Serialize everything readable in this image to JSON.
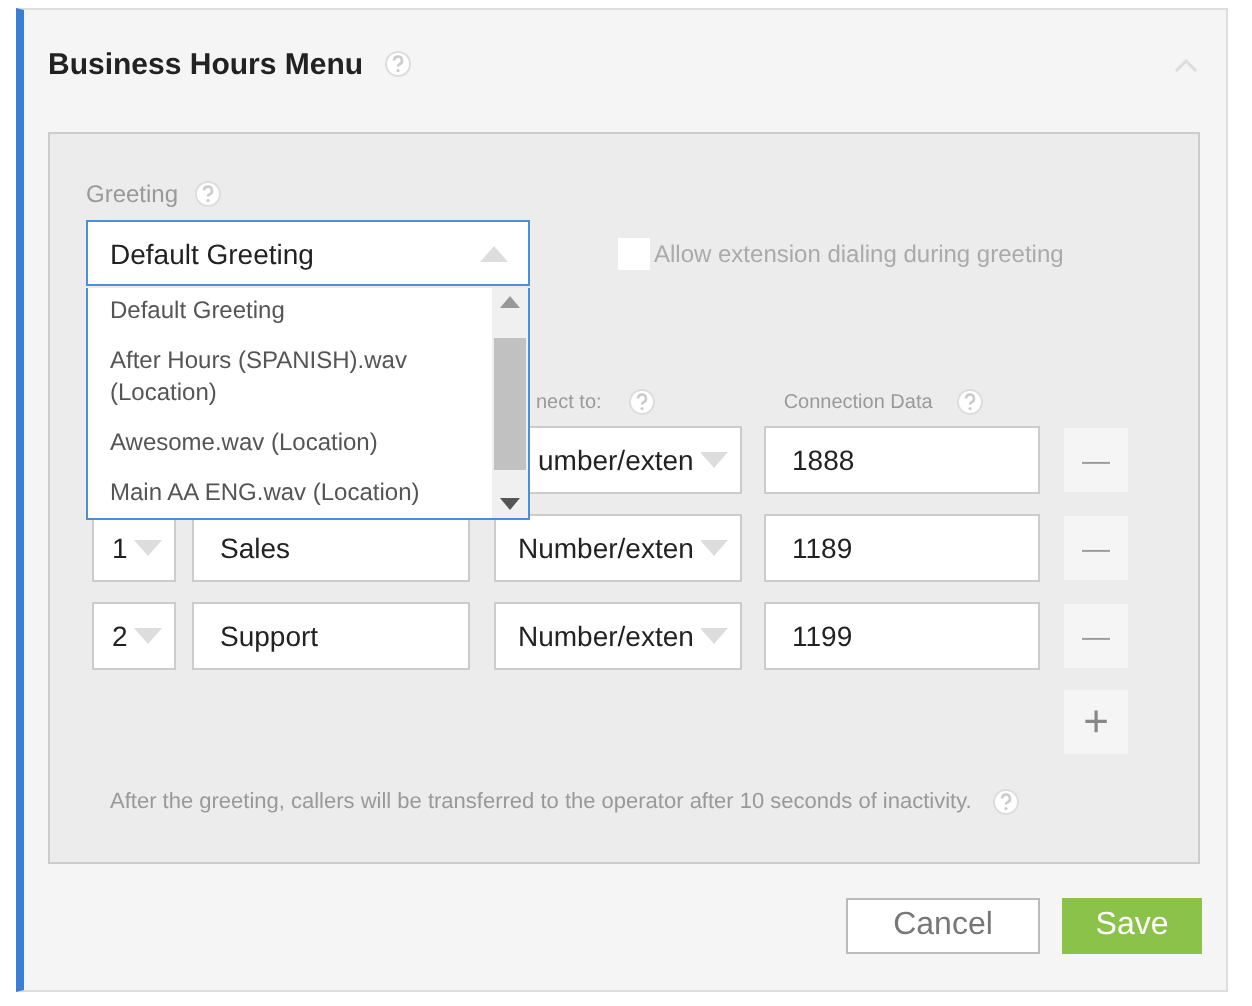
{
  "title": "Business Hours Menu",
  "greeting": {
    "label": "Greeting",
    "value": "Default Greeting",
    "open": true,
    "options": [
      {
        "label": "Default Greeting"
      },
      {
        "label": "After Hours (SPANISH).wav (Location)"
      },
      {
        "label": "Awesome.wav (Location)"
      },
      {
        "label": "Main AA ENG.wav (Location)"
      }
    ]
  },
  "extension_dialing": {
    "label": "Allow extension dialing during greeting",
    "checked": false
  },
  "columns": [
    "nect to:",
    "Connection Data"
  ],
  "rows": [
    {
      "connect": "umber/exten",
      "data": "1888"
    },
    {
      "key": "1",
      "name": "Sales",
      "connect": "Number/exten",
      "data": "1189"
    },
    {
      "key": "2",
      "name": "Support",
      "connect": "Number/exten",
      "data": "1199"
    }
  ],
  "add_label": "+",
  "remove_label": "—",
  "note": "After the greeting, callers will be transferred to the operator after 10 seconds of inactivity.",
  "buttons": [
    {
      "label": "Cancel",
      "kind": "secondary"
    },
    {
      "label": "Save",
      "kind": "primary"
    }
  ]
}
